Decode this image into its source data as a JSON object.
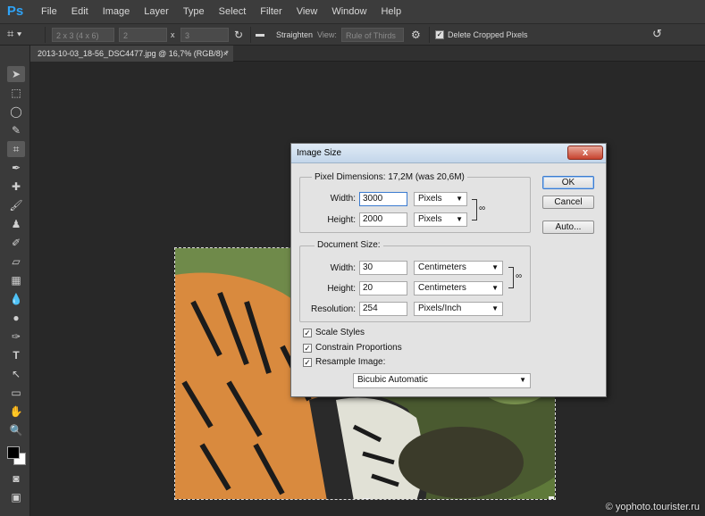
{
  "app": {
    "logo": "Ps"
  },
  "menu": [
    "File",
    "Edit",
    "Image",
    "Layer",
    "Type",
    "Select",
    "Filter",
    "View",
    "Window",
    "Help"
  ],
  "options_bar": {
    "preset": "2 x 3 (4 x 6)",
    "width_value": "2",
    "x_label": "x",
    "height_value": "3",
    "straighten_label": "Straighten",
    "view_label": "View:",
    "view_value": "Rule of Thirds",
    "delete_cropped_label": "Delete Cropped Pixels",
    "delete_cropped_checked": true
  },
  "document_tab": {
    "title": "2013-10-03_18-56_DSC4477.jpg @ 16,7% (RGB/8) *",
    "close": "×"
  },
  "dialog": {
    "title": "Image Size",
    "close": "x",
    "pixel_dimensions": {
      "label": "Pixel Dimensions:",
      "value": "17,2M (was 20,6M)",
      "width_label": "Width:",
      "width_value": "3000",
      "width_unit": "Pixels",
      "height_label": "Height:",
      "height_value": "2000",
      "height_unit": "Pixels"
    },
    "document_size": {
      "label": "Document Size:",
      "width_label": "Width:",
      "width_value": "30",
      "width_unit": "Centimeters",
      "height_label": "Height:",
      "height_value": "20",
      "height_unit": "Centimeters",
      "resolution_label": "Resolution:",
      "resolution_value": "254",
      "resolution_unit": "Pixels/Inch"
    },
    "options": {
      "scale_styles": "Scale Styles",
      "constrain_proportions": "Constrain Proportions",
      "resample_image": "Resample Image:",
      "resample_method": "Bicubic Automatic"
    },
    "buttons": {
      "ok": "OK",
      "cancel": "Cancel",
      "auto": "Auto..."
    }
  },
  "watermark": "© yophoto.tourister.ru"
}
